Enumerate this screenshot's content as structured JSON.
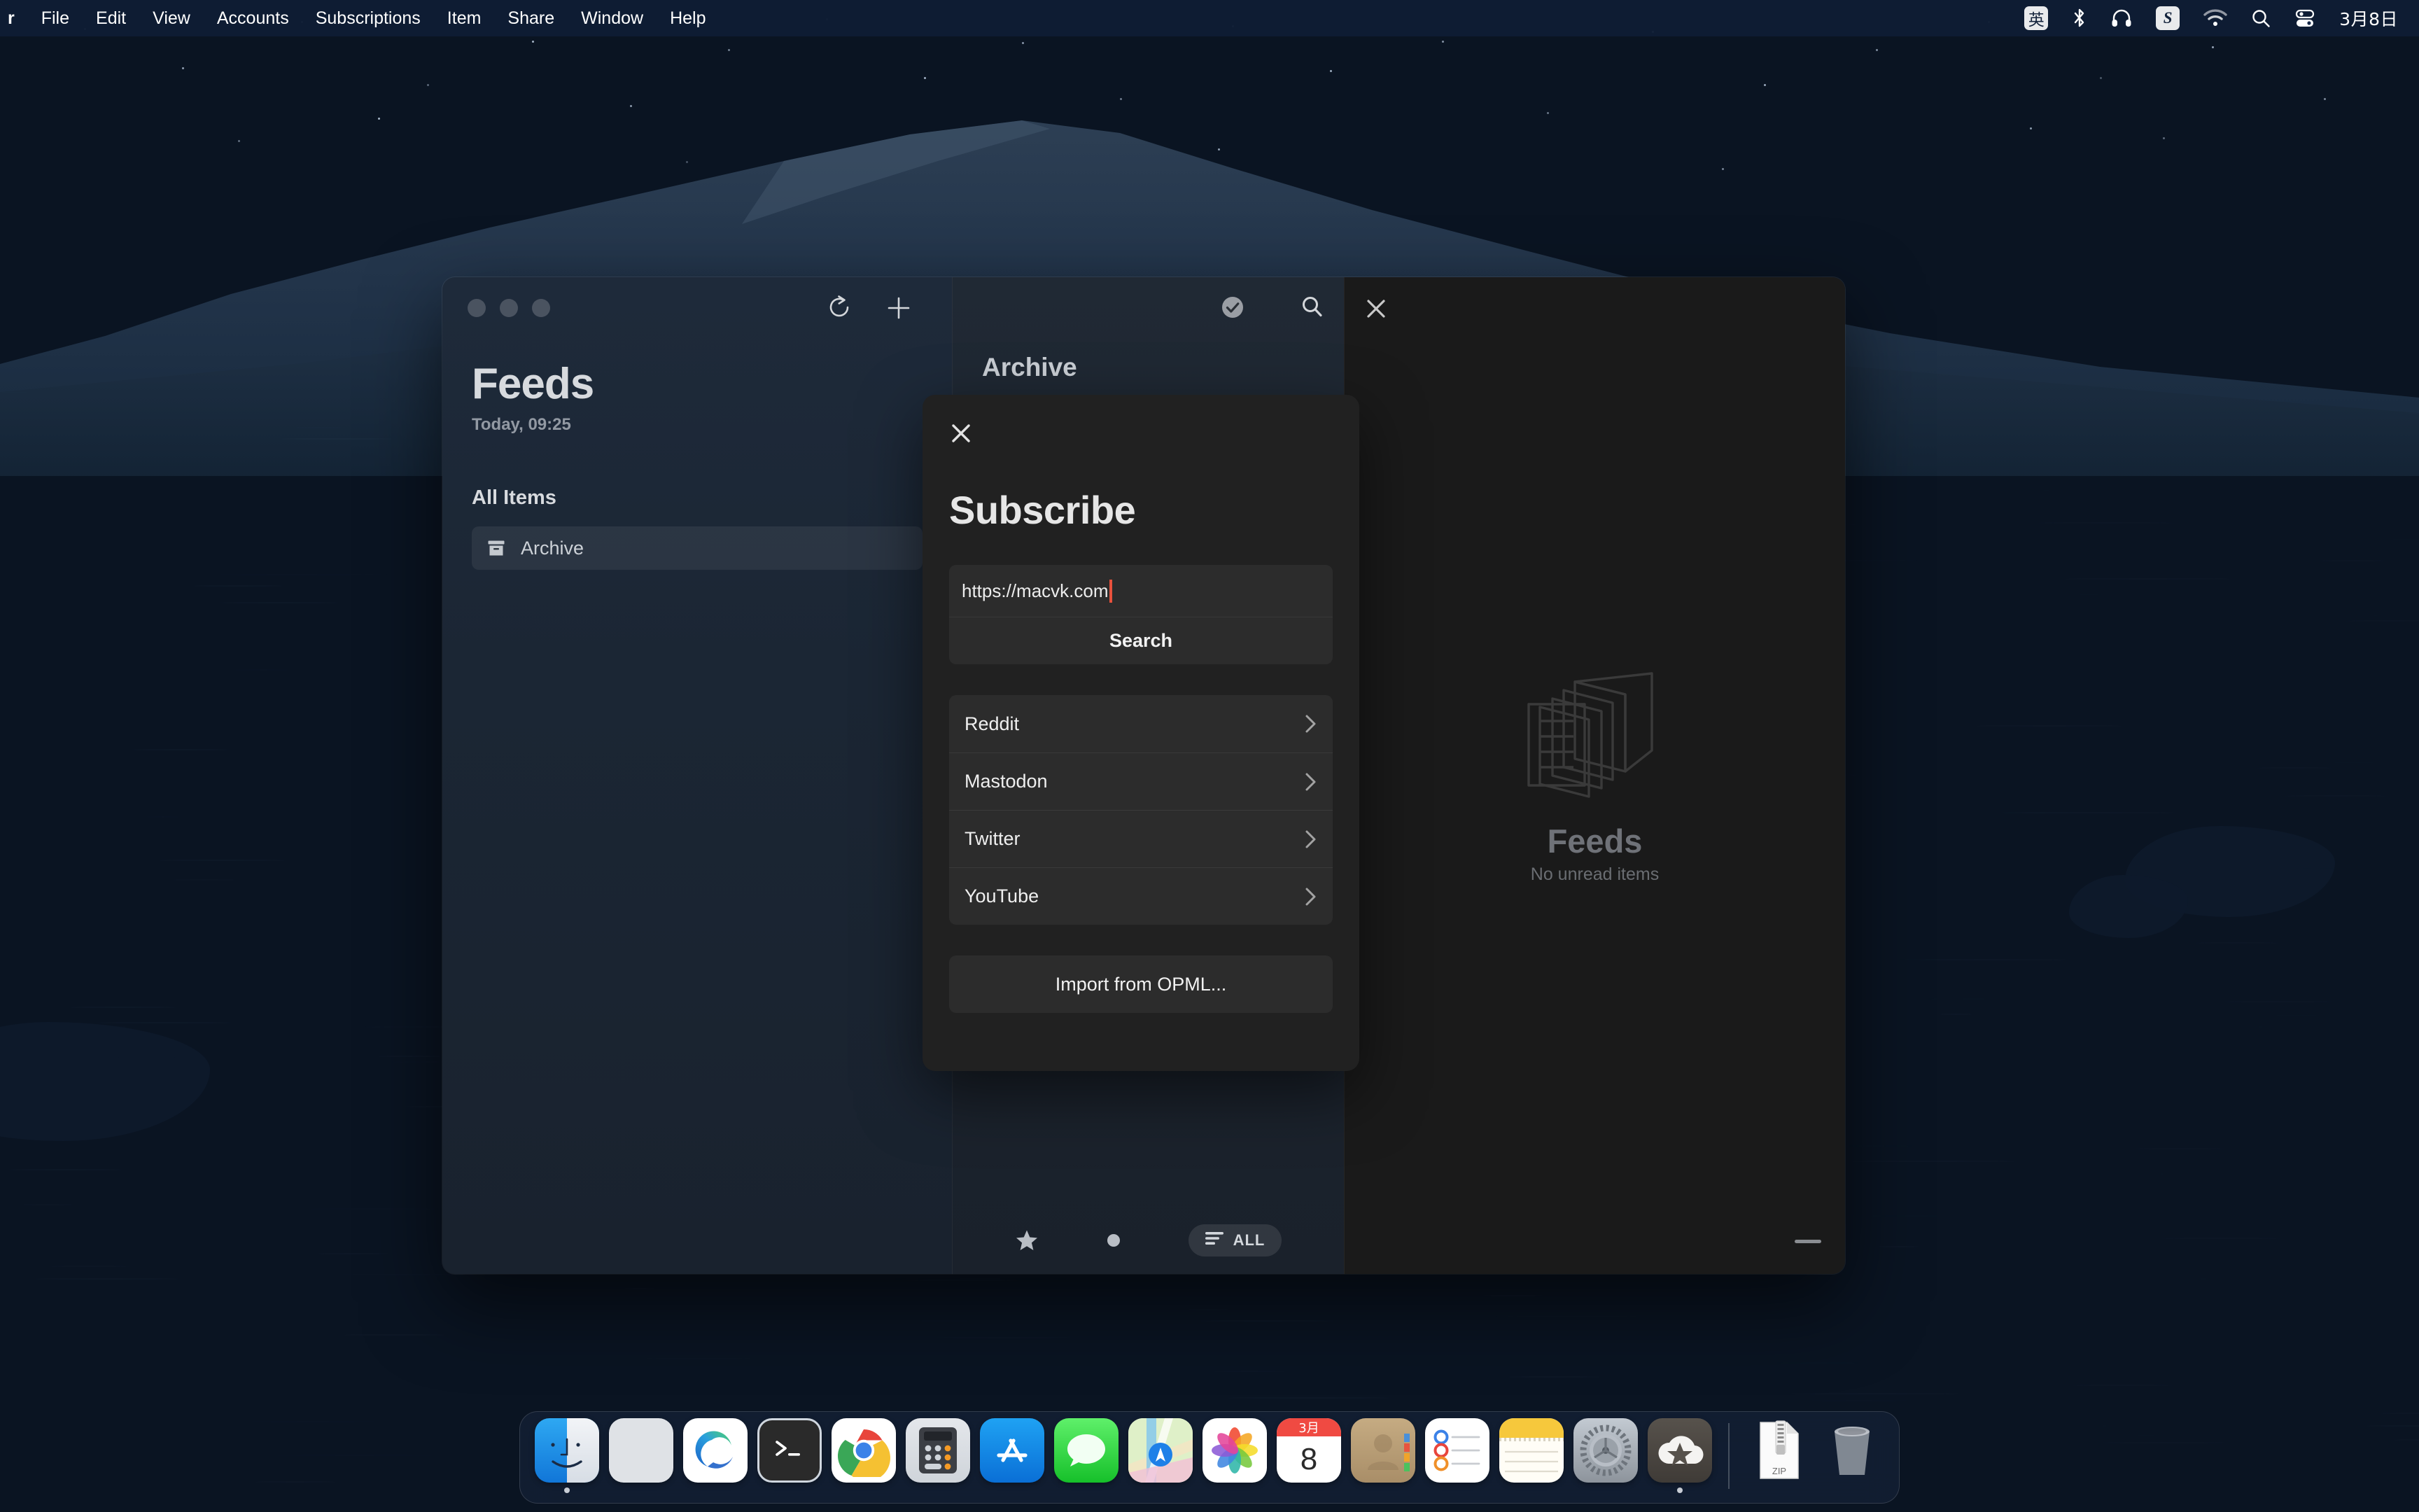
{
  "menubar": {
    "apple_logo": "",
    "items": [
      {
        "label": "r",
        "app": true
      },
      {
        "label": "File"
      },
      {
        "label": "Edit"
      },
      {
        "label": "View"
      },
      {
        "label": "Accounts"
      },
      {
        "label": "Subscriptions"
      },
      {
        "label": "Item"
      },
      {
        "label": "Share"
      },
      {
        "label": "Window"
      },
      {
        "label": "Help"
      }
    ],
    "status_icons": [
      {
        "name": "input-method-icon",
        "glyph": "英"
      },
      {
        "name": "bluetooth-icon",
        "glyph": ""
      },
      {
        "name": "headphones-icon",
        "glyph": ""
      },
      {
        "name": "sogou-input-icon",
        "glyph": "S"
      },
      {
        "name": "wifi-icon",
        "glyph": ""
      },
      {
        "name": "spotlight-search-icon",
        "glyph": ""
      },
      {
        "name": "control-center-icon",
        "glyph": ""
      }
    ],
    "date": "3月8日"
  },
  "window": {
    "sidebar": {
      "title": "Feeds",
      "subtitle": "Today, 09:25",
      "section_title": "All Items",
      "items": [
        {
          "label": "Archive",
          "icon": "archive-icon",
          "selected": true
        }
      ],
      "toolbar": {
        "refresh": "refresh-icon",
        "add": "plus-icon"
      }
    },
    "list_pane": {
      "title": "Archive",
      "toolbar": {
        "mark_read": "check-circle-icon",
        "search": "search-icon"
      },
      "bottom_bar": {
        "star": "star-icon",
        "unread": "dot-icon",
        "filter_label": "ALL"
      }
    },
    "detail_pane": {
      "close": "close-icon",
      "empty_title": "Feeds",
      "empty_subtitle": "No unread items",
      "resize_handle": "minus-icon"
    }
  },
  "modal": {
    "close_icon": "close-icon",
    "title": "Subscribe",
    "url_value": "https://macvk.com",
    "search_label": "Search",
    "services": [
      {
        "label": "Reddit"
      },
      {
        "label": "Mastodon"
      },
      {
        "label": "Twitter"
      },
      {
        "label": "YouTube"
      }
    ],
    "import_label": "Import from OPML..."
  },
  "dock": {
    "items": [
      {
        "name": "finder",
        "label": "Finder",
        "running": true
      },
      {
        "name": "launchpad",
        "label": "Launchpad",
        "running": false
      },
      {
        "name": "edge",
        "label": "Microsoft Edge",
        "running": false
      },
      {
        "name": "terminal",
        "label": "Terminal",
        "running": false
      },
      {
        "name": "chrome",
        "label": "Google Chrome",
        "running": false
      },
      {
        "name": "calculator",
        "label": "Calculator",
        "running": false
      },
      {
        "name": "app-store",
        "label": "App Store",
        "running": false
      },
      {
        "name": "messages",
        "label": "Messages",
        "running": false
      },
      {
        "name": "maps",
        "label": "Maps",
        "running": false
      },
      {
        "name": "photos",
        "label": "Photos",
        "running": false
      },
      {
        "name": "calendar",
        "label": "Calendar",
        "running": false,
        "month": "3月",
        "day": "8"
      },
      {
        "name": "contacts",
        "label": "Contacts",
        "running": false
      },
      {
        "name": "reminders",
        "label": "Reminders",
        "running": false
      },
      {
        "name": "notes",
        "label": "Notes",
        "running": false
      },
      {
        "name": "system-preferences",
        "label": "System Preferences",
        "running": false
      },
      {
        "name": "feeds",
        "label": "Feeds",
        "running": true
      }
    ],
    "files": [
      {
        "name": "zip-archive",
        "label": "ZIP"
      },
      {
        "name": "trash",
        "label": "Trash"
      }
    ]
  }
}
